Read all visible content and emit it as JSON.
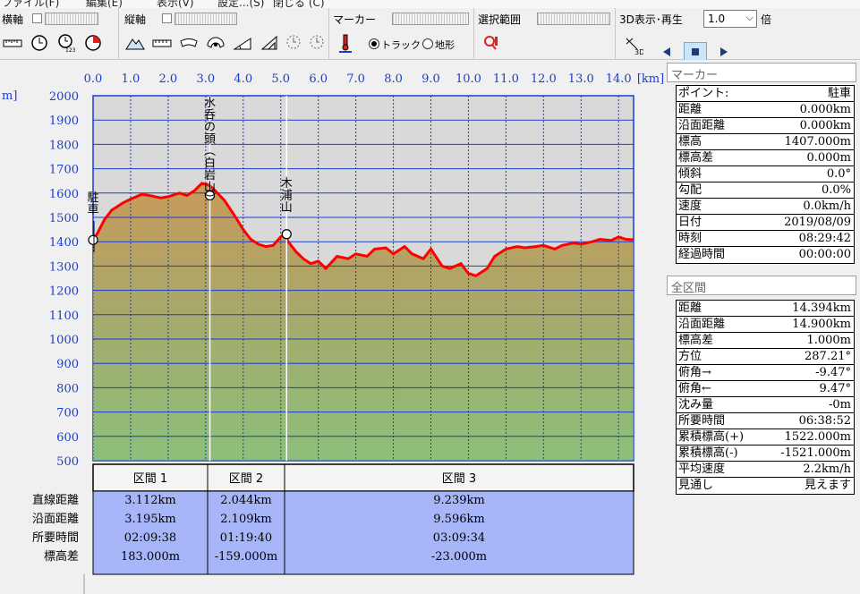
{
  "menu": [
    "ファイル(F)",
    "編集(E)",
    "表示(V)",
    "設定...(S)",
    "閉じる (C)"
  ],
  "toolbar": {
    "h_axis_label": "横軸",
    "v_axis_label": "縦軸",
    "marker_label": "マーカー",
    "selection_label": "選択範囲",
    "play3d_label": "3D表示･再生",
    "zoom_value": "1.0",
    "zoom_unit": "倍",
    "track_radio": "トラック",
    "terrain_radio": "地形"
  },
  "chart_data": {
    "type": "area",
    "x_unit": "[km]",
    "y_unit": "m]",
    "xlim": [
      0,
      14.4
    ],
    "ylim": [
      500,
      2000
    ],
    "x_ticks": [
      "0.0",
      "1.0",
      "2.0",
      "3.0",
      "4.0",
      "5.0",
      "6.0",
      "7.0",
      "8.0",
      "9.0",
      "10.0",
      "11.0",
      "12.0",
      "13.0",
      "14.0"
    ],
    "y_ticks": [
      "2000",
      "1900",
      "1800",
      "1700",
      "1600",
      "1500",
      "1400",
      "1300",
      "1200",
      "1100",
      "1000",
      "900",
      "800",
      "700",
      "600",
      "500"
    ],
    "x": [
      0,
      0.1,
      0.3,
      0.5,
      0.8,
      1.0,
      1.3,
      1.5,
      1.8,
      2.0,
      2.3,
      2.5,
      2.7,
      2.9,
      3.05,
      3.15,
      3.25,
      3.5,
      3.8,
      4.0,
      4.2,
      4.4,
      4.6,
      4.8,
      5.0,
      5.1,
      5.2,
      5.4,
      5.6,
      5.8,
      6.0,
      6.2,
      6.5,
      6.8,
      7.0,
      7.3,
      7.5,
      7.8,
      8.0,
      8.3,
      8.5,
      8.8,
      9.0,
      9.3,
      9.5,
      9.8,
      10.0,
      10.2,
      10.5,
      10.7,
      11.0,
      11.3,
      11.5,
      11.8,
      12.0,
      12.3,
      12.5,
      12.8,
      13.0,
      13.3,
      13.5,
      13.8,
      14.0,
      14.2,
      14.394
    ],
    "y": [
      1407,
      1430,
      1490,
      1530,
      1560,
      1575,
      1595,
      1590,
      1580,
      1585,
      1600,
      1590,
      1610,
      1640,
      1635,
      1625,
      1610,
      1570,
      1500,
      1450,
      1410,
      1390,
      1380,
      1385,
      1420,
      1430,
      1400,
      1360,
      1330,
      1310,
      1320,
      1290,
      1340,
      1330,
      1350,
      1340,
      1370,
      1375,
      1350,
      1380,
      1350,
      1330,
      1370,
      1300,
      1290,
      1310,
      1270,
      1260,
      1290,
      1340,
      1370,
      1380,
      1375,
      1380,
      1385,
      1370,
      1385,
      1395,
      1390,
      1400,
      1410,
      1405,
      1420,
      1410,
      1408
    ],
    "markers": [
      {
        "label": "駐車",
        "x": 0,
        "y": 1407
      },
      {
        "label": "水呑の頭(白岩山)",
        "x": 3.112,
        "y": 1590
      },
      {
        "label": "木浦山",
        "x": 5.156,
        "y": 1431
      }
    ],
    "line_color": "#ff0000",
    "plot_bg": "#d9d9d9",
    "grid_color": "#1a3dd1",
    "sections": {
      "headers": [
        "区間 1",
        "区間 2",
        "区間 3"
      ],
      "row_labels": [
        "直線距離",
        "沿面距離",
        "所要時間",
        "標高差"
      ],
      "rows": [
        [
          "3.112km",
          "2.044km",
          "9.239km"
        ],
        [
          "3.195km",
          "2.109km",
          "9.596km"
        ],
        [
          "02:09:38",
          "01:19:40",
          "03:09:34"
        ],
        [
          "183.000m",
          "-159.000m",
          "-23.000m"
        ]
      ]
    }
  },
  "marker_panel": {
    "title": "マーカー",
    "rows": [
      {
        "k": "ポイント:",
        "v": "駐車"
      },
      {
        "k": "距離",
        "v": "0.000km"
      },
      {
        "k": "沿面距離",
        "v": "0.000km"
      },
      {
        "k": "標高",
        "v": "1407.000m"
      },
      {
        "k": "標高差",
        "v": "0.000m"
      },
      {
        "k": "傾斜",
        "v": "0.0°"
      },
      {
        "k": "勾配",
        "v": "0.0%"
      },
      {
        "k": "速度",
        "v": "0.0km/h"
      },
      {
        "k": "日付",
        "v": "2019/08/09"
      },
      {
        "k": "時刻",
        "v": "08:29:42"
      },
      {
        "k": "経過時間",
        "v": "00:00:00"
      }
    ]
  },
  "total_panel": {
    "title": "全区間",
    "rows": [
      {
        "k": "距離",
        "v": "14.394km"
      },
      {
        "k": "沿面距離",
        "v": "14.900km"
      },
      {
        "k": "標高差",
        "v": "1.000m"
      },
      {
        "k": "方位",
        "v": "287.21°"
      },
      {
        "k": "俯角→",
        "v": "-9.47°"
      },
      {
        "k": "俯角←",
        "v": "9.47°"
      },
      {
        "k": "沈み量",
        "v": "-0m"
      },
      {
        "k": "所要時間",
        "v": "06:38:52"
      },
      {
        "k": "累積標高(+)",
        "v": "1522.000m"
      },
      {
        "k": "累積標高(-)",
        "v": "-1521.000m"
      },
      {
        "k": "平均速度",
        "v": "2.2km/h"
      },
      {
        "k": "見通し",
        "v": "見えます"
      }
    ]
  }
}
